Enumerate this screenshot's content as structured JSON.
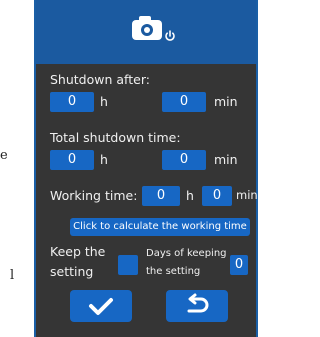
{
  "side_text": {
    "top": "e",
    "bottom": "l"
  },
  "header": {
    "camera_icon": "camera-icon",
    "power_icon": "power-icon"
  },
  "shutdown_after": {
    "label": "Shutdown after:",
    "hours": "0",
    "hours_unit": "h",
    "minutes": "0",
    "minutes_unit": "min"
  },
  "total_shutdown": {
    "label": "Total shutdown time:",
    "hours": "0",
    "hours_unit": "h",
    "minutes": "0",
    "minutes_unit": "min"
  },
  "working_time": {
    "label": "Working time:",
    "hours": "0",
    "hours_unit": "h",
    "minutes": "0",
    "minutes_unit": "min"
  },
  "calculate_button": "Click to calculate the working time",
  "keep_setting": {
    "label_line1": "Keep the",
    "label_line2": "setting"
  },
  "days_keeping": {
    "label_line1": "Days of keeping",
    "label_line2": "the setting",
    "value": "0"
  },
  "actions": {
    "confirm_icon": "checkmark-icon",
    "back_icon": "undo-arrow-icon"
  },
  "colors": {
    "panel": "#353535",
    "header": "#1b5aa0",
    "accent": "#1767c4"
  }
}
